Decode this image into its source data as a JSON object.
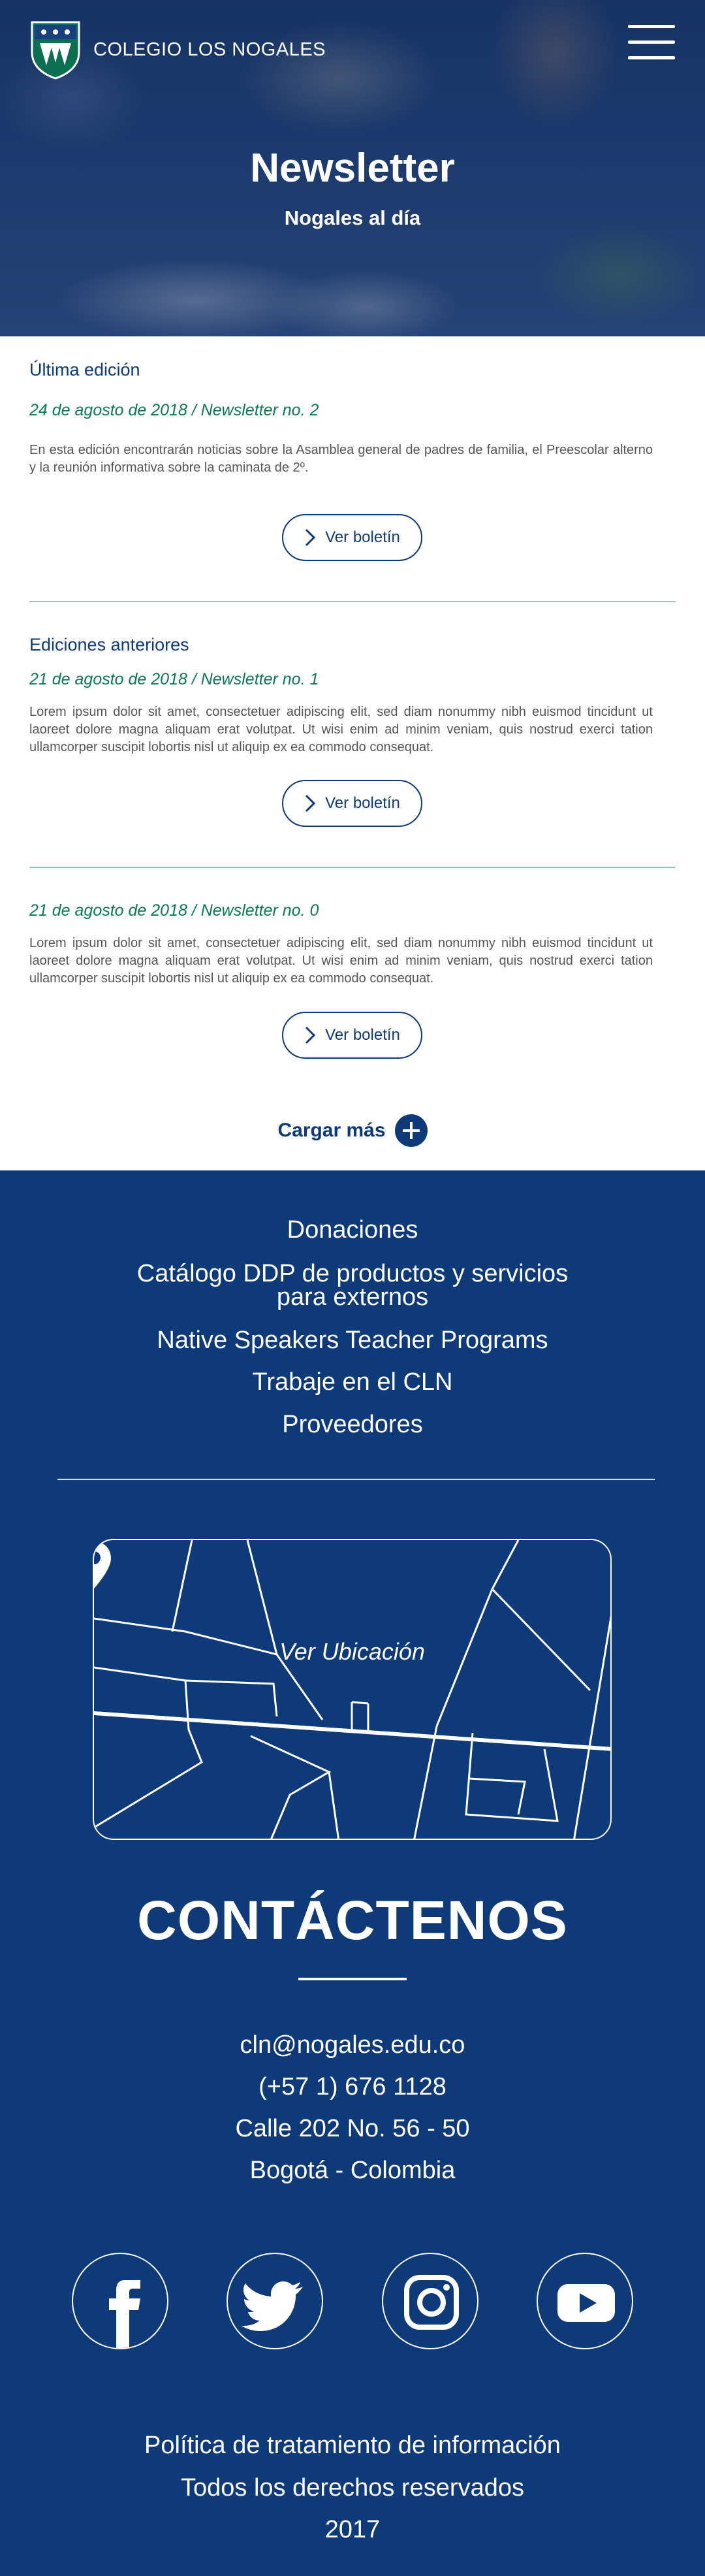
{
  "header": {
    "logo_text": "COLEGIO LOS NOGALES",
    "title": "Newsletter",
    "subtitle": "Nogales al día"
  },
  "latest": {
    "section_title": "Última edición",
    "date": "24 de agosto de 2018 / Newsletter no. 2",
    "description": "En esta edición encontrarán noticias sobre la Asamblea general de padres de familia, el Preescolar alterno y la reunión informativa sobre la caminata de 2º.",
    "button_label": "Ver boletín"
  },
  "previous": {
    "section_title": "Ediciones anteriores",
    "items": [
      {
        "date": "21 de agosto de 2018 / Newsletter no. 1",
        "description": "Lorem ipsum dolor sit amet, consectetuer adipiscing elit, sed diam nonummy nibh euismod tincidunt ut laoreet dolore magna aliquam erat volutpat. Ut wisi enim ad minim veniam, quis nostrud exerci tation ullamcorper suscipit lobortis nisl ut aliquip ex ea commodo consequat.",
        "button_label": "Ver boletín"
      },
      {
        "date": "21 de agosto de 2018 / Newsletter no. 0",
        "description": "Lorem ipsum dolor sit amet, consectetuer adipiscing elit, sed diam nonummy nibh euismod tincidunt ut laoreet dolore magna aliquam erat volutpat. Ut wisi enim ad minim veniam, quis nostrud exerci tation ullamcorper suscipit lobortis nisl ut aliquip ex ea commodo consequat.",
        "button_label": "Ver boletín"
      }
    ],
    "load_more_label": "Cargar más"
  },
  "footer": {
    "links": [
      "Donaciones",
      "Catálogo DDP de productos y servicios",
      "para externos",
      "Native Speakers Teacher Programs",
      "Trabaje en el CLN",
      "Proveedores"
    ],
    "map_label": "Ver Ubicación",
    "contact_title": "CONTÁCTENOS",
    "contact": {
      "email": "cln@nogales.edu.co",
      "phone": "(+57 1) 676 1128",
      "address": "Calle 202 No. 56 - 50",
      "city": "Bogotá - Colombia"
    },
    "social_icons": [
      "facebook-icon",
      "twitter-icon",
      "instagram-icon",
      "youtube-icon"
    ],
    "legal": [
      "Política de tratamiento de información",
      "Todos los derechos reservados",
      "2017"
    ]
  },
  "colors": {
    "brand_blue": "#0f3a7a",
    "brand_green": "#0b7a57",
    "divider_green": "#8fc9b4"
  }
}
